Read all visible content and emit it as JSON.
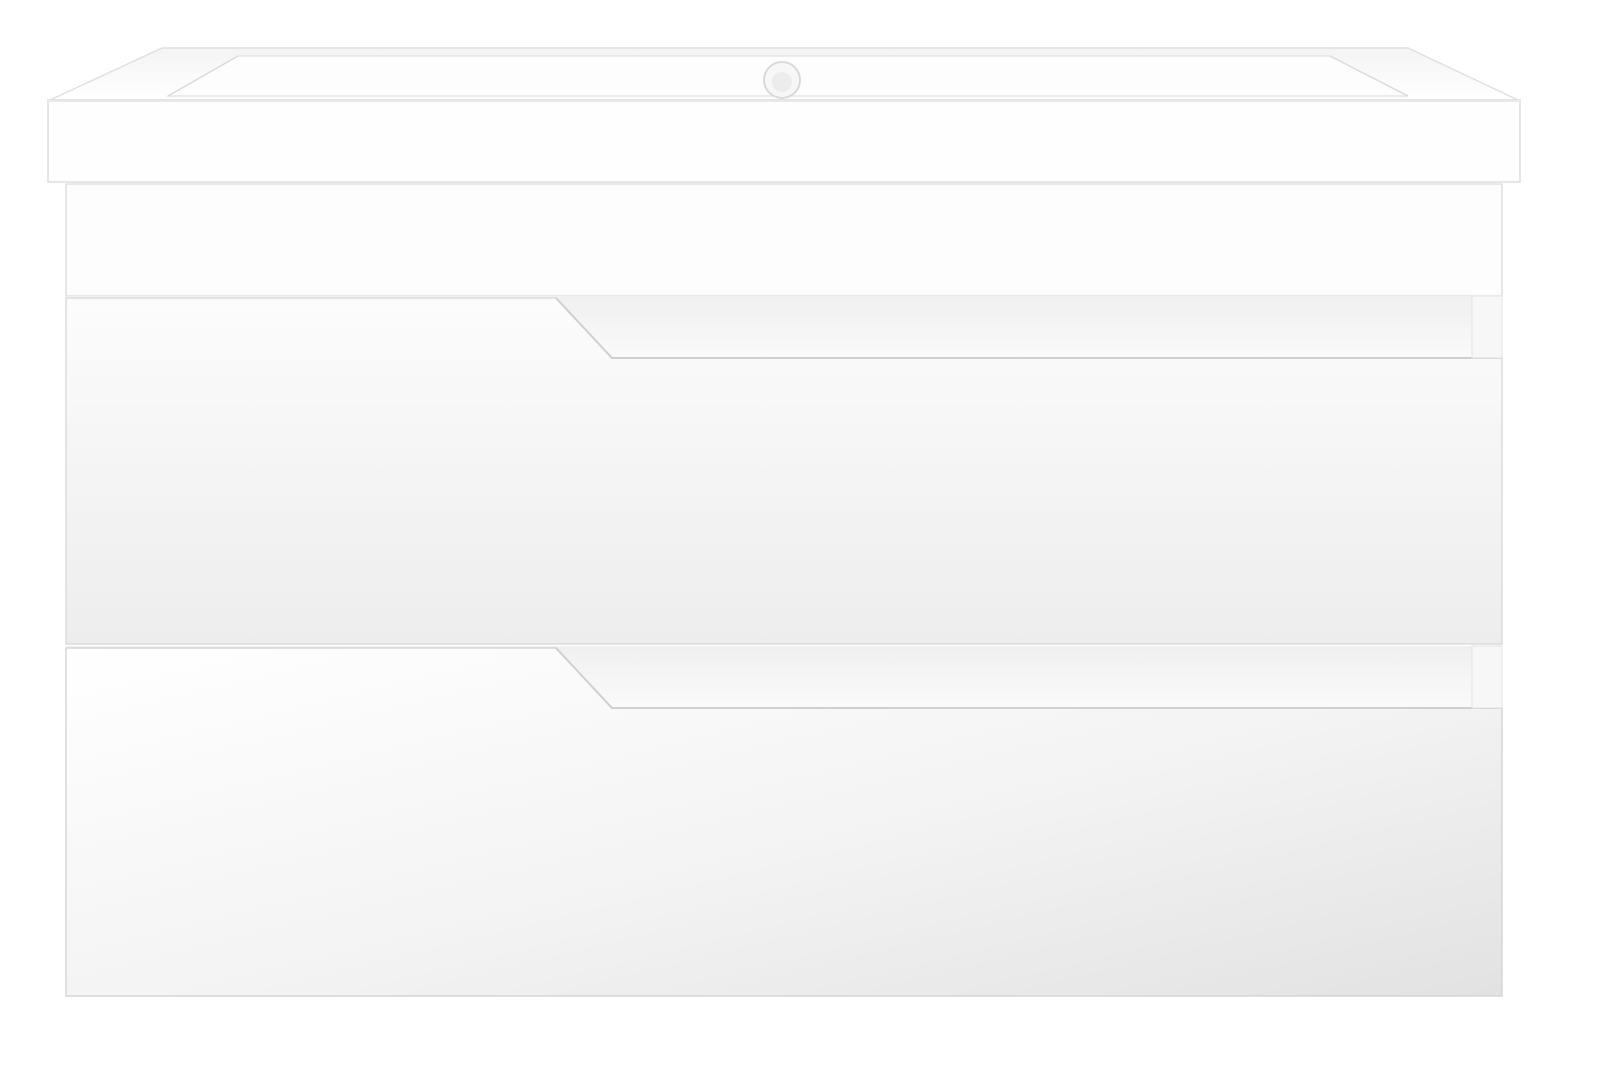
{
  "image": {
    "subject": "",
    "colors": {
      "background": "#ffffff",
      "surface_light": "#fafafa",
      "surface_mid": "#f0f0f0",
      "surface_shade": "#e4e4e4",
      "edge": "#d8d8d8",
      "basin_inner": "#f6f6f6"
    }
  },
  "vanity": {
    "drawers": [
      {
        "id": "top"
      },
      {
        "id": "bottom"
      }
    ],
    "basin": {
      "overflow_hole": true
    }
  }
}
